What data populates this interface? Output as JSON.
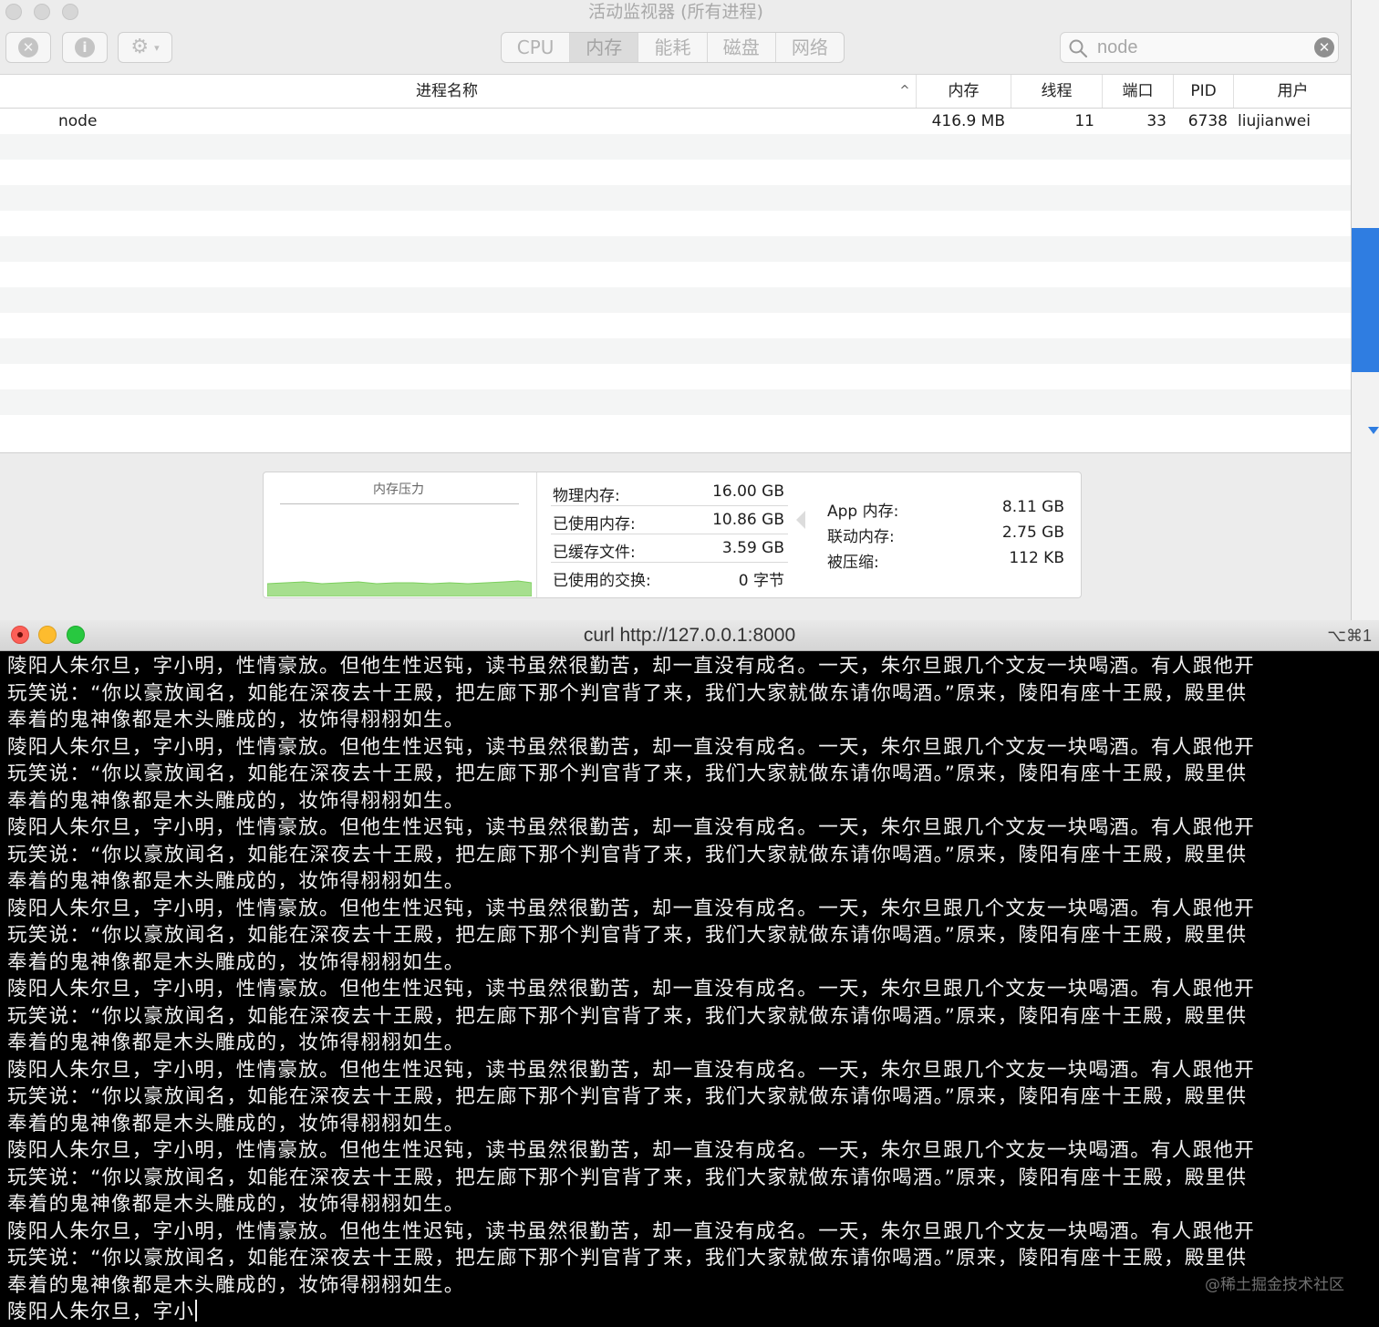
{
  "activity_monitor": {
    "title": "活动监视器 (所有进程)",
    "toolbar": {
      "stop_icon": "x-circle-icon",
      "info_icon": "info-icon",
      "gear_icon": "gear-icon"
    },
    "tabs": [
      {
        "label": "CPU",
        "active": false
      },
      {
        "label": "内存",
        "active": true
      },
      {
        "label": "能耗",
        "active": false
      },
      {
        "label": "磁盘",
        "active": false
      },
      {
        "label": "网络",
        "active": false
      }
    ],
    "search": {
      "value": "node"
    },
    "columns": {
      "name": "进程名称",
      "memory": "内存",
      "threads": "线程",
      "ports": "端口",
      "pid": "PID",
      "user": "用户"
    },
    "rows": [
      {
        "name": "node",
        "memory": "416.9 MB",
        "threads": "11",
        "ports": "33",
        "pid": "6738",
        "user": "liujianwei"
      }
    ],
    "memory_pressure": {
      "title": "内存压力",
      "color": "#a6df8e"
    },
    "stats": {
      "physical": {
        "label": "物理内存:",
        "value": "16.00 GB"
      },
      "used": {
        "label": "已使用内存:",
        "value": "10.86 GB"
      },
      "cached": {
        "label": "已缓存文件:",
        "value": "3.59 GB"
      },
      "swap": {
        "label": "已使用的交换:",
        "value": "0 字节"
      },
      "app": {
        "label": "App 内存:",
        "value": "8.11 GB"
      },
      "wired": {
        "label": "联动内存:",
        "value": "2.75 GB"
      },
      "compressed": {
        "label": "被压缩:",
        "value": "112 KB"
      }
    }
  },
  "terminal": {
    "title": "curl http://127.0.0.1:8000",
    "shortcut": "⌥⌘1",
    "lines": [
      "陵阳人朱尔旦，字小明，性情豪放。但他生性迟钝，读书虽然很勤苦，却一直没有成名。一天，朱尔旦跟几个文友一块喝酒。有人跟他开",
      "玩笑说：“你以豪放闻名，如能在深夜去十王殿，把左廊下那个判官背了来，我们大家就做东请你喝酒。”原来，陵阳有座十王殿，殿里供",
      "奉着的鬼神像都是木头雕成的，妆饰得栩栩如生。",
      "陵阳人朱尔旦，字小明，性情豪放。但他生性迟钝，读书虽然很勤苦，却一直没有成名。一天，朱尔旦跟几个文友一块喝酒。有人跟他开",
      "玩笑说：“你以豪放闻名，如能在深夜去十王殿，把左廊下那个判官背了来，我们大家就做东请你喝酒。”原来，陵阳有座十王殿，殿里供",
      "奉着的鬼神像都是木头雕成的，妆饰得栩栩如生。",
      "陵阳人朱尔旦，字小明，性情豪放。但他生性迟钝，读书虽然很勤苦，却一直没有成名。一天，朱尔旦跟几个文友一块喝酒。有人跟他开",
      "玩笑说：“你以豪放闻名，如能在深夜去十王殿，把左廊下那个判官背了来，我们大家就做东请你喝酒。”原来，陵阳有座十王殿，殿里供",
      "奉着的鬼神像都是木头雕成的，妆饰得栩栩如生。",
      "陵阳人朱尔旦，字小明，性情豪放。但他生性迟钝，读书虽然很勤苦，却一直没有成名。一天，朱尔旦跟几个文友一块喝酒。有人跟他开",
      "玩笑说：“你以豪放闻名，如能在深夜去十王殿，把左廊下那个判官背了来，我们大家就做东请你喝酒。”原来，陵阳有座十王殿，殿里供",
      "奉着的鬼神像都是木头雕成的，妆饰得栩栩如生。",
      "陵阳人朱尔旦，字小明，性情豪放。但他生性迟钝，读书虽然很勤苦，却一直没有成名。一天，朱尔旦跟几个文友一块喝酒。有人跟他开",
      "玩笑说：“你以豪放闻名，如能在深夜去十王殿，把左廊下那个判官背了来，我们大家就做东请你喝酒。”原来，陵阳有座十王殿，殿里供",
      "奉着的鬼神像都是木头雕成的，妆饰得栩栩如生。",
      "陵阳人朱尔旦，字小明，性情豪放。但他生性迟钝，读书虽然很勤苦，却一直没有成名。一天，朱尔旦跟几个文友一块喝酒。有人跟他开",
      "玩笑说：“你以豪放闻名，如能在深夜去十王殿，把左廊下那个判官背了来，我们大家就做东请你喝酒。”原来，陵阳有座十王殿，殿里供",
      "奉着的鬼神像都是木头雕成的，妆饰得栩栩如生。",
      "陵阳人朱尔旦，字小明，性情豪放。但他生性迟钝，读书虽然很勤苦，却一直没有成名。一天，朱尔旦跟几个文友一块喝酒。有人跟他开",
      "玩笑说：“你以豪放闻名，如能在深夜去十王殿，把左廊下那个判官背了来，我们大家就做东请你喝酒。”原来，陵阳有座十王殿，殿里供",
      "奉着的鬼神像都是木头雕成的，妆饰得栩栩如生。",
      "陵阳人朱尔旦，字小明，性情豪放。但他生性迟钝，读书虽然很勤苦，却一直没有成名。一天，朱尔旦跟几个文友一块喝酒。有人跟他开",
      "玩笑说：“你以豪放闻名，如能在深夜去十王殿，把左廊下那个判官背了来，我们大家就做东请你喝酒。”原来，陵阳有座十王殿，殿里供",
      "奉着的鬼神像都是木头雕成的，妆饰得栩栩如生。"
    ],
    "current_line": "陵阳人朱尔旦，字小",
    "watermark": "@稀土掘金技术社区"
  }
}
